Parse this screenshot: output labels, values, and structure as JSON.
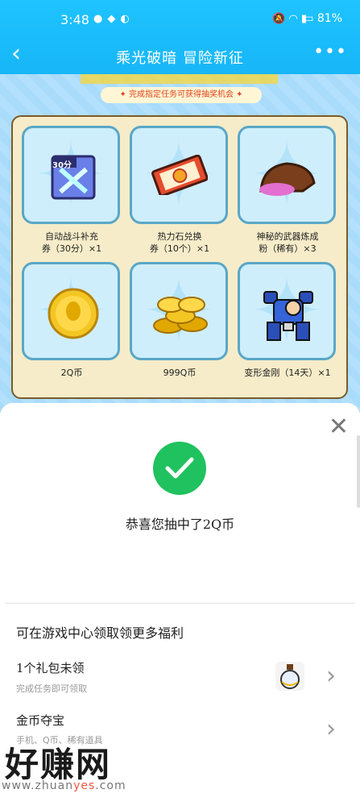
{
  "status_bar": {
    "time": "3:48",
    "battery": "81%"
  },
  "navbar": {
    "title": "乘光破暗 冒险新征",
    "more": "•••"
  },
  "banner": {
    "tip": "✦ 完成指定任务可获得抽奖机会 ✦"
  },
  "prizes": [
    {
      "line1": "自动战斗补充",
      "line2": "券（30分）×1",
      "icon": "ticket-30-icon",
      "badge": "30分"
    },
    {
      "line1": "热力石兑换",
      "line2": "券（10个）×1",
      "icon": "fire-stone-ticket-icon"
    },
    {
      "line1": "神秘的武器炼成",
      "line2": "粉（稀有）×3",
      "icon": "powder-bag-icon"
    },
    {
      "line1": "2Q币",
      "line2": "",
      "icon": "single-coin-icon"
    },
    {
      "line1": "999Q币",
      "line2": "",
      "icon": "coin-pile-icon"
    },
    {
      "line1": "变形金刚（14天）×1",
      "line2": "",
      "icon": "mecha-robot-icon"
    }
  ],
  "result": {
    "message": "恭喜您抽中了2Q币",
    "accent": "#1fc25e"
  },
  "more_benefits": {
    "title": "可在游戏中心领取领更多福利",
    "rows": [
      {
        "title": "1个礼包未领",
        "subtitle": "完成任务即可领取",
        "icon": "potion-bottle-icon"
      },
      {
        "title": "金币夺宝",
        "subtitle": "手机、Q币、稀有道具"
      }
    ]
  },
  "watermark": {
    "text": "好赚网",
    "url_a": "www.zhuan",
    "url_b": "yes",
    "url_c": ".com"
  }
}
